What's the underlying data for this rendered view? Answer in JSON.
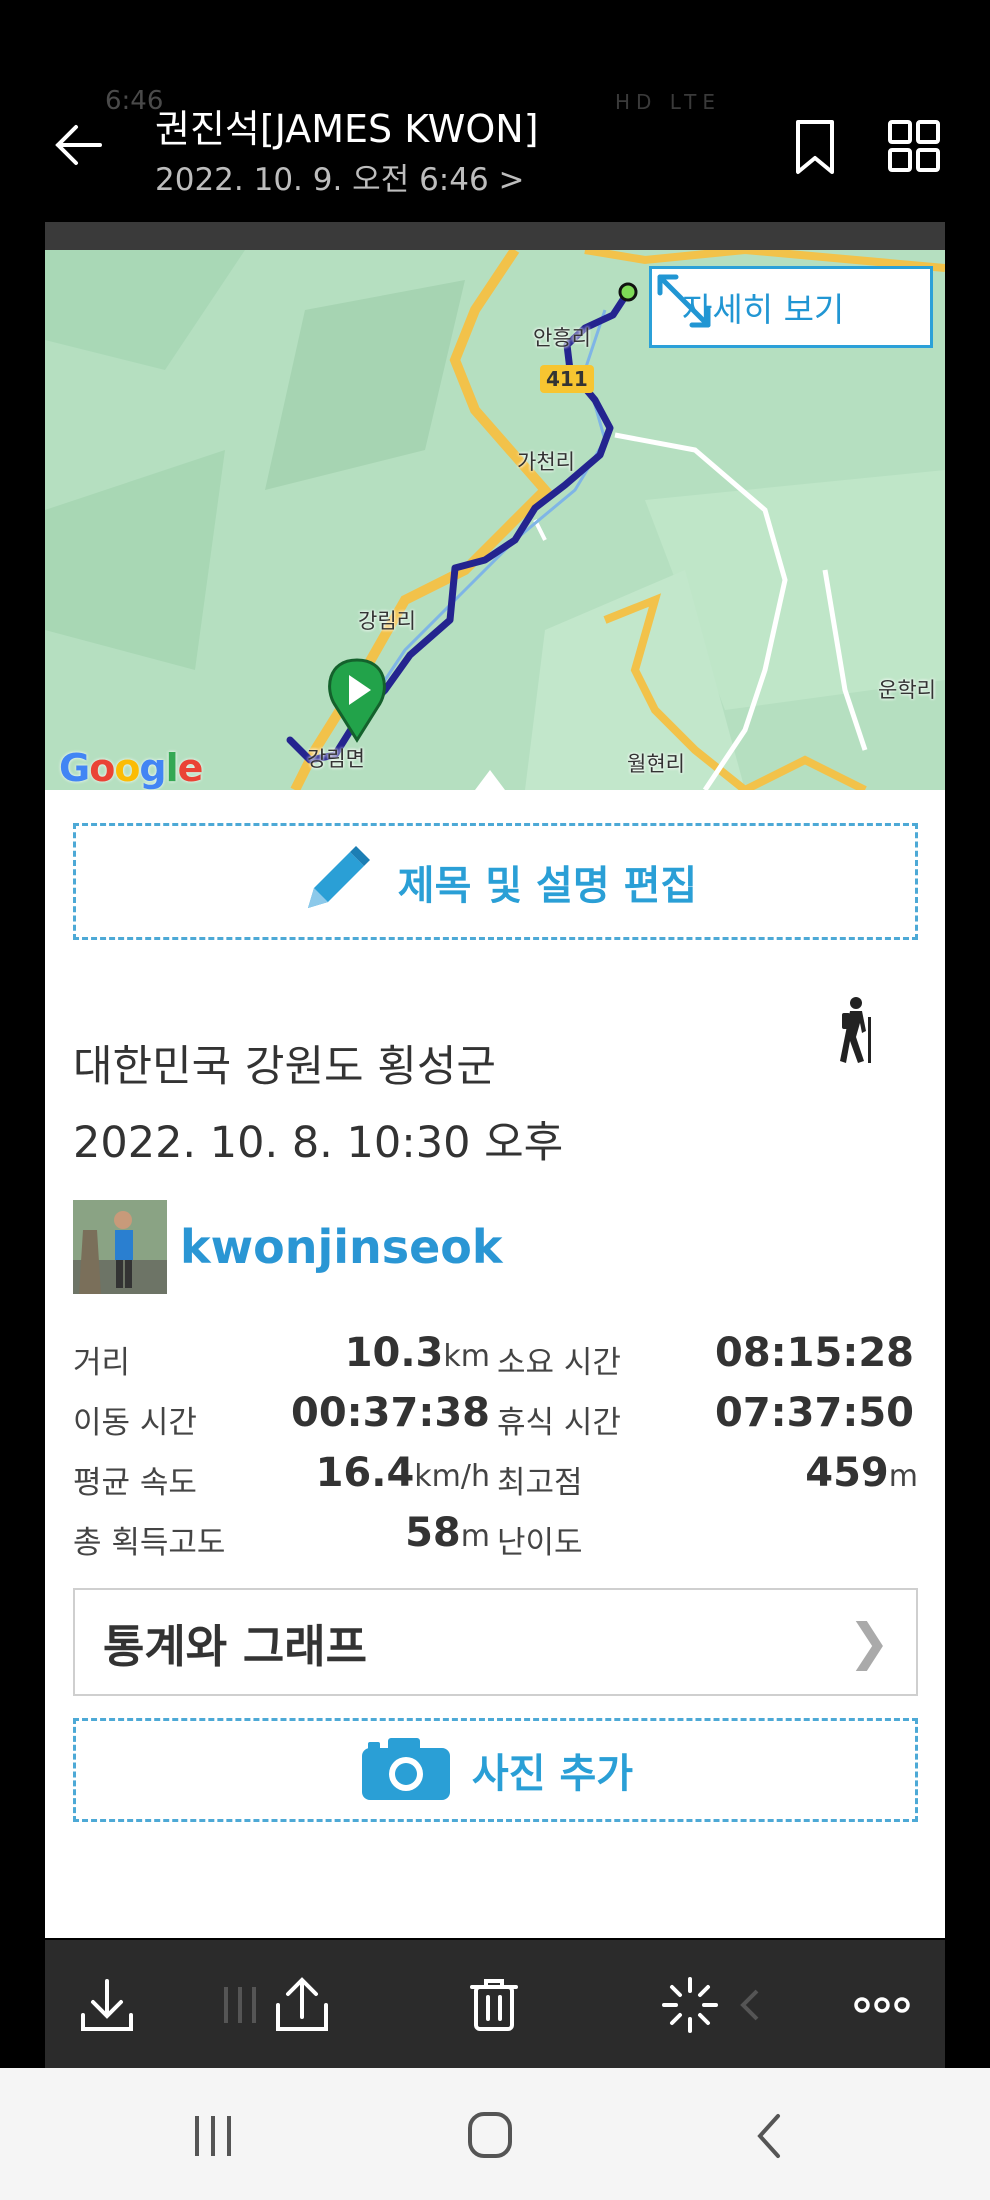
{
  "status_ghost": {
    "time": "6:46",
    "indicators": "HD LTE"
  },
  "header": {
    "title": "권진석[JAMES KWON]",
    "subtitle": "2022. 10. 9. 오전 6:46 >"
  },
  "map": {
    "detail_button_label": "자세히 보기",
    "google_logo": "Google",
    "labels": {
      "anheung": "안흥리",
      "road": "411",
      "gacheon": "가천리",
      "gangnim_ri": "강림리",
      "unhak": "운학리",
      "gangnim_myeon": "강림면",
      "wolhyeon": "월현리"
    }
  },
  "edit_button_label": "제목 및 설명 편집",
  "activity": {
    "location": "대한민국 강원도 횡성군",
    "datetime": "2022. 10. 8. 10:30 오후",
    "activity_icon": "hiking-icon",
    "username": "kwonjinseok"
  },
  "stats": {
    "distance": {
      "label": "거리",
      "value": "10.3",
      "unit": "km"
    },
    "duration": {
      "label": "소요 시간",
      "value": "08:15:28"
    },
    "moving_time": {
      "label": "이동 시간",
      "value": "00:37:38"
    },
    "rest_time": {
      "label": "휴식 시간",
      "value": "07:37:50"
    },
    "avg_speed": {
      "label": "평균 속도",
      "value": "16.4",
      "unit": "km/h"
    },
    "max_elevation": {
      "label": "최고점",
      "value": "459",
      "unit": "m"
    },
    "total_ascent": {
      "label": "총 획득고도",
      "value": "58",
      "unit": "m"
    },
    "difficulty": {
      "label": "난이도"
    }
  },
  "stats_graph_button_label": "통계와 그래프",
  "add_photo_button_label": "사진 추가",
  "colors": {
    "accent": "#2a9fd6",
    "route": "#24248f",
    "map_bg": "#b5dfc0"
  }
}
